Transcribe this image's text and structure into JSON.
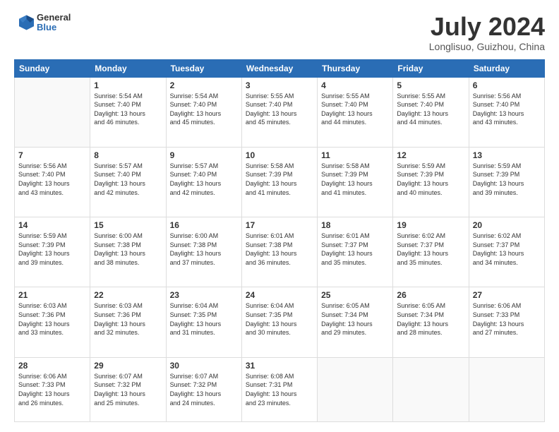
{
  "header": {
    "logo_line1": "General",
    "logo_line2": "Blue",
    "month": "July 2024",
    "location": "Longlisuo, Guizhou, China"
  },
  "weekdays": [
    "Sunday",
    "Monday",
    "Tuesday",
    "Wednesday",
    "Thursday",
    "Friday",
    "Saturday"
  ],
  "weeks": [
    [
      {
        "day": "",
        "sunrise": "",
        "sunset": "",
        "daylight": ""
      },
      {
        "day": "1",
        "sunrise": "5:54 AM",
        "sunset": "7:40 PM",
        "daylight": "13 hours and 46 minutes."
      },
      {
        "day": "2",
        "sunrise": "5:54 AM",
        "sunset": "7:40 PM",
        "daylight": "13 hours and 45 minutes."
      },
      {
        "day": "3",
        "sunrise": "5:55 AM",
        "sunset": "7:40 PM",
        "daylight": "13 hours and 45 minutes."
      },
      {
        "day": "4",
        "sunrise": "5:55 AM",
        "sunset": "7:40 PM",
        "daylight": "13 hours and 44 minutes."
      },
      {
        "day": "5",
        "sunrise": "5:55 AM",
        "sunset": "7:40 PM",
        "daylight": "13 hours and 44 minutes."
      },
      {
        "day": "6",
        "sunrise": "5:56 AM",
        "sunset": "7:40 PM",
        "daylight": "13 hours and 43 minutes."
      }
    ],
    [
      {
        "day": "7",
        "sunrise": "5:56 AM",
        "sunset": "7:40 PM",
        "daylight": "13 hours and 43 minutes."
      },
      {
        "day": "8",
        "sunrise": "5:57 AM",
        "sunset": "7:40 PM",
        "daylight": "13 hours and 42 minutes."
      },
      {
        "day": "9",
        "sunrise": "5:57 AM",
        "sunset": "7:40 PM",
        "daylight": "13 hours and 42 minutes."
      },
      {
        "day": "10",
        "sunrise": "5:58 AM",
        "sunset": "7:39 PM",
        "daylight": "13 hours and 41 minutes."
      },
      {
        "day": "11",
        "sunrise": "5:58 AM",
        "sunset": "7:39 PM",
        "daylight": "13 hours and 41 minutes."
      },
      {
        "day": "12",
        "sunrise": "5:59 AM",
        "sunset": "7:39 PM",
        "daylight": "13 hours and 40 minutes."
      },
      {
        "day": "13",
        "sunrise": "5:59 AM",
        "sunset": "7:39 PM",
        "daylight": "13 hours and 39 minutes."
      }
    ],
    [
      {
        "day": "14",
        "sunrise": "5:59 AM",
        "sunset": "7:39 PM",
        "daylight": "13 hours and 39 minutes."
      },
      {
        "day": "15",
        "sunrise": "6:00 AM",
        "sunset": "7:38 PM",
        "daylight": "13 hours and 38 minutes."
      },
      {
        "day": "16",
        "sunrise": "6:00 AM",
        "sunset": "7:38 PM",
        "daylight": "13 hours and 37 minutes."
      },
      {
        "day": "17",
        "sunrise": "6:01 AM",
        "sunset": "7:38 PM",
        "daylight": "13 hours and 36 minutes."
      },
      {
        "day": "18",
        "sunrise": "6:01 AM",
        "sunset": "7:37 PM",
        "daylight": "13 hours and 35 minutes."
      },
      {
        "day": "19",
        "sunrise": "6:02 AM",
        "sunset": "7:37 PM",
        "daylight": "13 hours and 35 minutes."
      },
      {
        "day": "20",
        "sunrise": "6:02 AM",
        "sunset": "7:37 PM",
        "daylight": "13 hours and 34 minutes."
      }
    ],
    [
      {
        "day": "21",
        "sunrise": "6:03 AM",
        "sunset": "7:36 PM",
        "daylight": "13 hours and 33 minutes."
      },
      {
        "day": "22",
        "sunrise": "6:03 AM",
        "sunset": "7:36 PM",
        "daylight": "13 hours and 32 minutes."
      },
      {
        "day": "23",
        "sunrise": "6:04 AM",
        "sunset": "7:35 PM",
        "daylight": "13 hours and 31 minutes."
      },
      {
        "day": "24",
        "sunrise": "6:04 AM",
        "sunset": "7:35 PM",
        "daylight": "13 hours and 30 minutes."
      },
      {
        "day": "25",
        "sunrise": "6:05 AM",
        "sunset": "7:34 PM",
        "daylight": "13 hours and 29 minutes."
      },
      {
        "day": "26",
        "sunrise": "6:05 AM",
        "sunset": "7:34 PM",
        "daylight": "13 hours and 28 minutes."
      },
      {
        "day": "27",
        "sunrise": "6:06 AM",
        "sunset": "7:33 PM",
        "daylight": "13 hours and 27 minutes."
      }
    ],
    [
      {
        "day": "28",
        "sunrise": "6:06 AM",
        "sunset": "7:33 PM",
        "daylight": "13 hours and 26 minutes."
      },
      {
        "day": "29",
        "sunrise": "6:07 AM",
        "sunset": "7:32 PM",
        "daylight": "13 hours and 25 minutes."
      },
      {
        "day": "30",
        "sunrise": "6:07 AM",
        "sunset": "7:32 PM",
        "daylight": "13 hours and 24 minutes."
      },
      {
        "day": "31",
        "sunrise": "6:08 AM",
        "sunset": "7:31 PM",
        "daylight": "13 hours and 23 minutes."
      },
      {
        "day": "",
        "sunrise": "",
        "sunset": "",
        "daylight": ""
      },
      {
        "day": "",
        "sunrise": "",
        "sunset": "",
        "daylight": ""
      },
      {
        "day": "",
        "sunrise": "",
        "sunset": "",
        "daylight": ""
      }
    ]
  ],
  "labels": {
    "sunrise_prefix": "Sunrise: ",
    "sunset_prefix": "Sunset: ",
    "daylight_prefix": "Daylight: "
  }
}
